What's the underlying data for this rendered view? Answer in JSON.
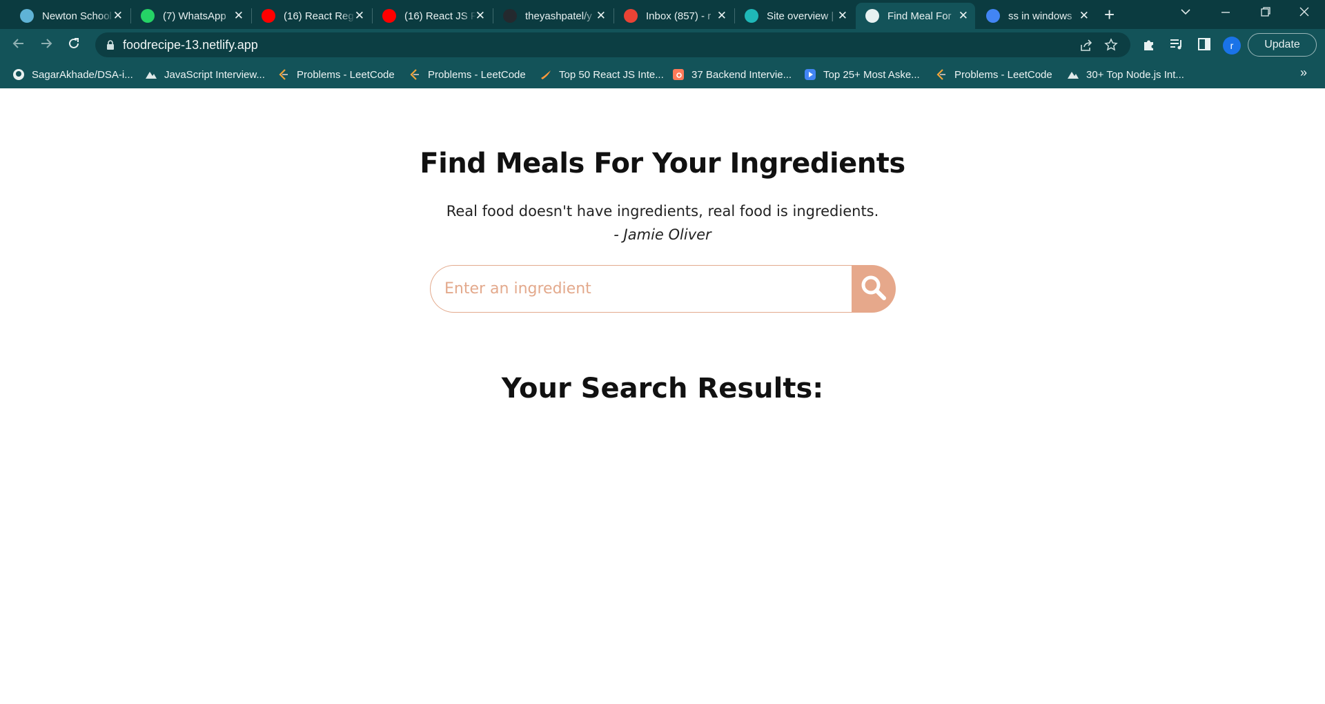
{
  "browser": {
    "tabs": [
      {
        "label": "Newton School",
        "icon": "newton-icon",
        "color": "#5fb3d6",
        "active": false
      },
      {
        "label": "(7) WhatsApp",
        "icon": "whatsapp-icon",
        "color": "#25d366",
        "active": false
      },
      {
        "label": "(16) React Reg",
        "icon": "youtube-icon",
        "color": "#ff0000",
        "active": false
      },
      {
        "label": "(16) React JS P",
        "icon": "youtube-icon",
        "color": "#ff0000",
        "active": false
      },
      {
        "label": "theyashpatel/y",
        "icon": "github-icon",
        "color": "#24292e",
        "active": false
      },
      {
        "label": "Inbox (857) - r",
        "icon": "gmail-icon",
        "color": "#ea4335",
        "active": false
      },
      {
        "label": "Site overview |",
        "icon": "netlify-icon",
        "color": "#1fb8b8",
        "active": false
      },
      {
        "label": "Find Meal For",
        "icon": "globe-icon",
        "color": "#e8f1f1",
        "active": true
      },
      {
        "label": "ss in windows",
        "icon": "google-icon",
        "color": "#4285f4",
        "active": false
      }
    ],
    "url": "foodrecipe-13.netlify.app",
    "update_label": "Update",
    "avatar_letter": "r",
    "bookmarks": [
      {
        "label": "SagarAkhade/DSA-i...",
        "icon": "github-icon"
      },
      {
        "label": "JavaScript Interview...",
        "icon": "mountain-icon"
      },
      {
        "label": "Problems - LeetCode",
        "icon": "leetcode-icon"
      },
      {
        "label": "Problems - LeetCode",
        "icon": "leetcode-icon"
      },
      {
        "label": "Top 50 React JS Inte...",
        "icon": "bird-icon"
      },
      {
        "label": "37 Backend Intervie...",
        "icon": "hubspot-icon"
      },
      {
        "label": "Top 25+ Most Aske...",
        "icon": "square-play-icon"
      },
      {
        "label": "Problems - LeetCode",
        "icon": "leetcode-icon"
      },
      {
        "label": "30+ Top Node.js Int...",
        "icon": "mountain-icon"
      }
    ]
  },
  "page": {
    "title": "Find Meals For Your Ingredients",
    "quote": "Real food doesn't have ingredients, real food is ingredients.",
    "author": "- Jamie Oliver",
    "search": {
      "placeholder": "Enter an ingredient",
      "value": ""
    },
    "results_title": "Your Search Results:"
  },
  "colors": {
    "accent": "#e6a88b",
    "chrome_dark": "#0b3b40",
    "chrome": "#135359"
  }
}
